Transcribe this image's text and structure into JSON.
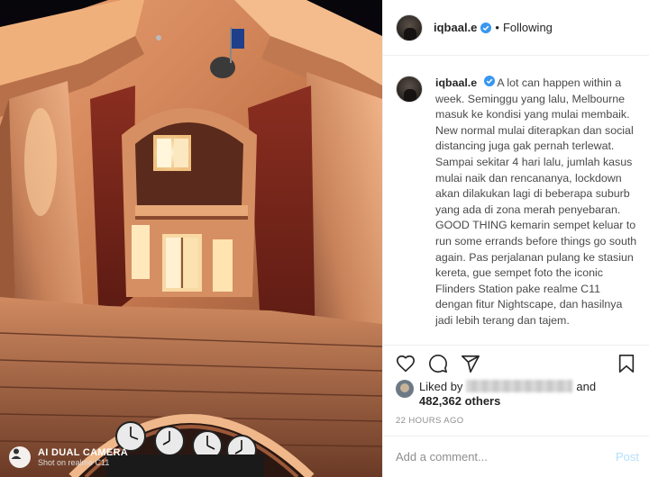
{
  "post": {
    "username": "iqbaal.e",
    "follow_status": "Following",
    "separator": "•",
    "verified_icon": "verified-badge-icon"
  },
  "photo": {
    "subject": "Flinders Street Station facade at night",
    "watermark_title": "AI DUAL CAMERA",
    "watermark_sub": "Shot on realme C11"
  },
  "caption": {
    "username": "iqbaal.e",
    "text": "A lot can happen within a week. Seminggu yang lalu, Melbourne masuk ke kondisi yang mulai membaik. New normal mulai diterapkan dan social distancing juga gak pernah terlewat. Sampai sekitar 4 hari lalu, jumlah kasus mulai naik dan rencananya, lockdown akan dilakukan lagi di beberapa suburb yang ada di zona merah penyebaran. GOOD THING kemarin sempet keluar to run some errands before things go south again. Pas perjalanan pulang ke stasiun kereta, gue sempet foto the iconic Flinders Station pake realme C11 dengan fitur Nightscape, dan hasilnya jadi lebih terang dan tajem."
  },
  "actions": {
    "like_icon": "heart-icon",
    "comment_icon": "comment-icon",
    "share_icon": "share-icon",
    "save_icon": "bookmark-icon"
  },
  "likes": {
    "prefix": "Liked by",
    "conjunction": "and",
    "count_text": "482,362 others"
  },
  "timestamp": "22 HOURS AGO",
  "comment": {
    "placeholder": "Add a comment...",
    "post_label": "Post"
  },
  "colors": {
    "accent_blue": "#0095f6",
    "post_disabled": "#b2dffc",
    "verified_blue": "#3897f0",
    "muted_text": "#8e8e8e"
  }
}
